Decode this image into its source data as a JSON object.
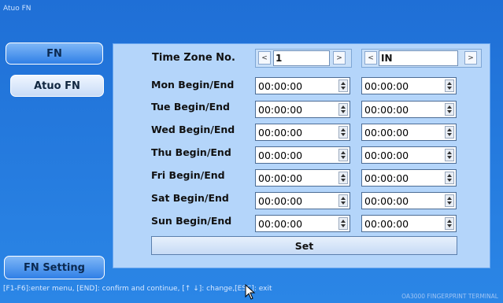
{
  "window": {
    "title": "Atuo FN"
  },
  "sidebar": {
    "fn_label": "FN",
    "atuo_fn_label": "Atuo FN",
    "fn_setting_label": "FN Setting"
  },
  "timezone": {
    "label": "Time Zone No.",
    "number": "1",
    "direction": "IN",
    "prev_glyph": "<",
    "next_glyph": ">"
  },
  "schedule": [
    {
      "day": "Mon Begin/End",
      "begin": "00:00:00",
      "end": "00:00:00"
    },
    {
      "day": "Tue Begin/End",
      "begin": "00:00:00",
      "end": "00:00:00"
    },
    {
      "day": "Wed Begin/End",
      "begin": "00:00:00",
      "end": "00:00:00"
    },
    {
      "day": "Thu Begin/End",
      "begin": "00:00:00",
      "end": "00:00:00"
    },
    {
      "day": "Fri Begin/End",
      "begin": "00:00:00",
      "end": "00:00:00"
    },
    {
      "day": "Sat Begin/End",
      "begin": "00:00:00",
      "end": "00:00:00"
    },
    {
      "day": "Sun Begin/End",
      "begin": "00:00:00",
      "end": "00:00:00"
    }
  ],
  "set_label": "Set",
  "status": {
    "help_text": "[F1-F6]:enter menu, [END]: confirm and continue, [↑ ↓]: change,[ESC]: exit",
    "brand": "OA3000 FINGERPRINT TERMINAL"
  }
}
